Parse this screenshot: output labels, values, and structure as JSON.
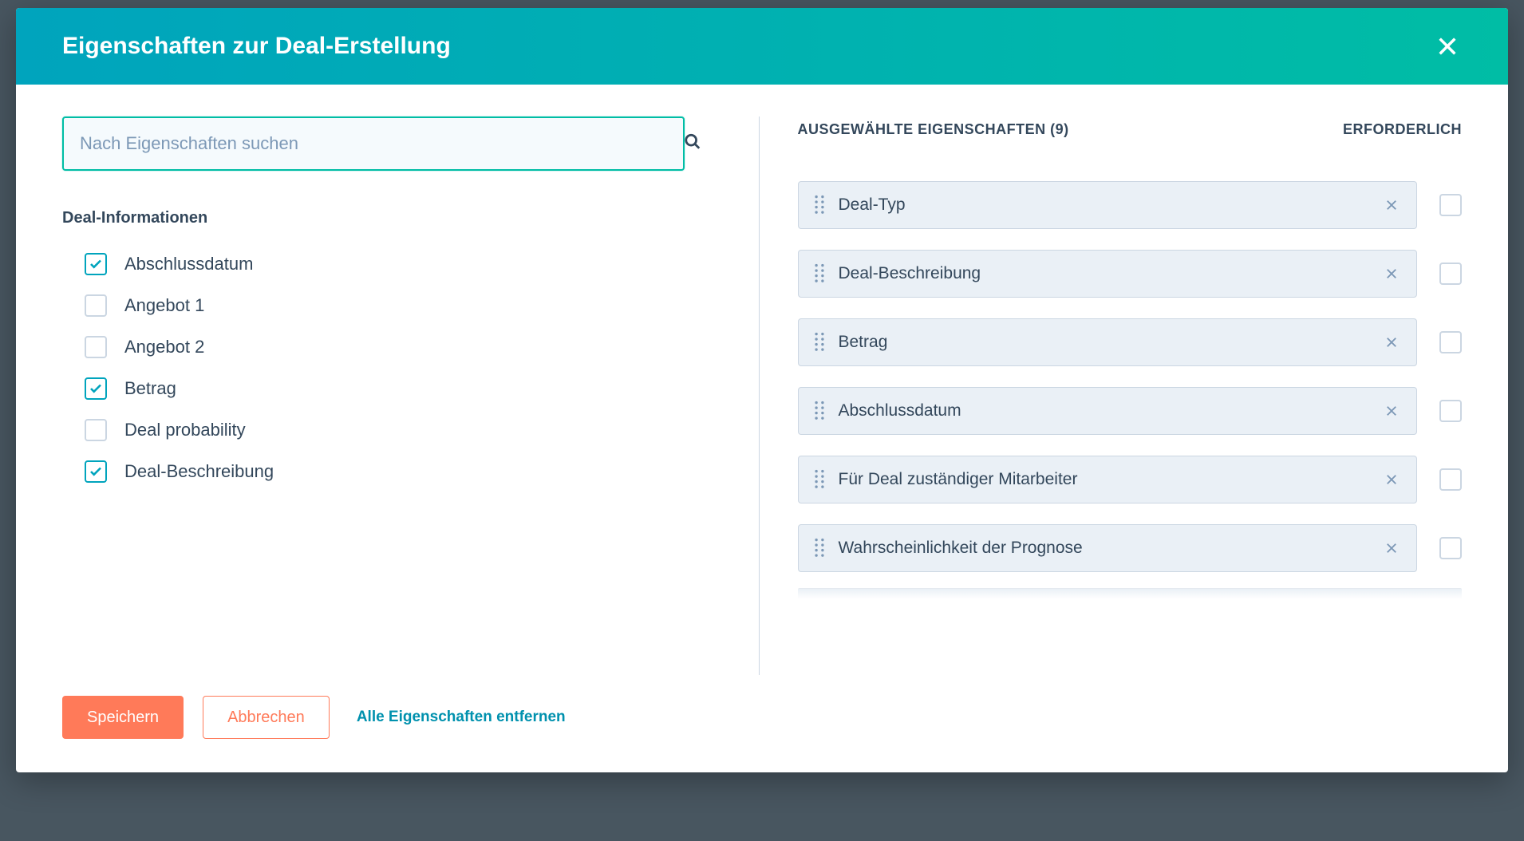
{
  "modal": {
    "title": "Eigenschaften zur Deal-Erstellung",
    "search_placeholder": "Nach Eigenschaften suchen"
  },
  "left": {
    "section_title": "Deal-Informationen",
    "properties": [
      {
        "label": "Abschlussdatum",
        "checked": true
      },
      {
        "label": "Angebot 1",
        "checked": false
      },
      {
        "label": "Angebot 2",
        "checked": false
      },
      {
        "label": "Betrag",
        "checked": true
      },
      {
        "label": "Deal probability",
        "checked": false
      },
      {
        "label": "Deal-Beschreibung",
        "checked": true
      }
    ]
  },
  "right": {
    "header_label": "AUSGEWÄHLTE EIGENSCHAFTEN (9)",
    "required_label": "ERFORDERLICH",
    "selected": [
      {
        "label": "Deal-Typ",
        "required": false
      },
      {
        "label": "Deal-Beschreibung",
        "required": false
      },
      {
        "label": "Betrag",
        "required": false
      },
      {
        "label": "Abschlussdatum",
        "required": false
      },
      {
        "label": "Für Deal zuständiger Mitarbeiter",
        "required": false
      },
      {
        "label": "Wahrscheinlichkeit der Prognose",
        "required": false
      }
    ]
  },
  "footer": {
    "save": "Speichern",
    "cancel": "Abbrechen",
    "remove_all": "Alle Eigenschaften entfernen"
  }
}
